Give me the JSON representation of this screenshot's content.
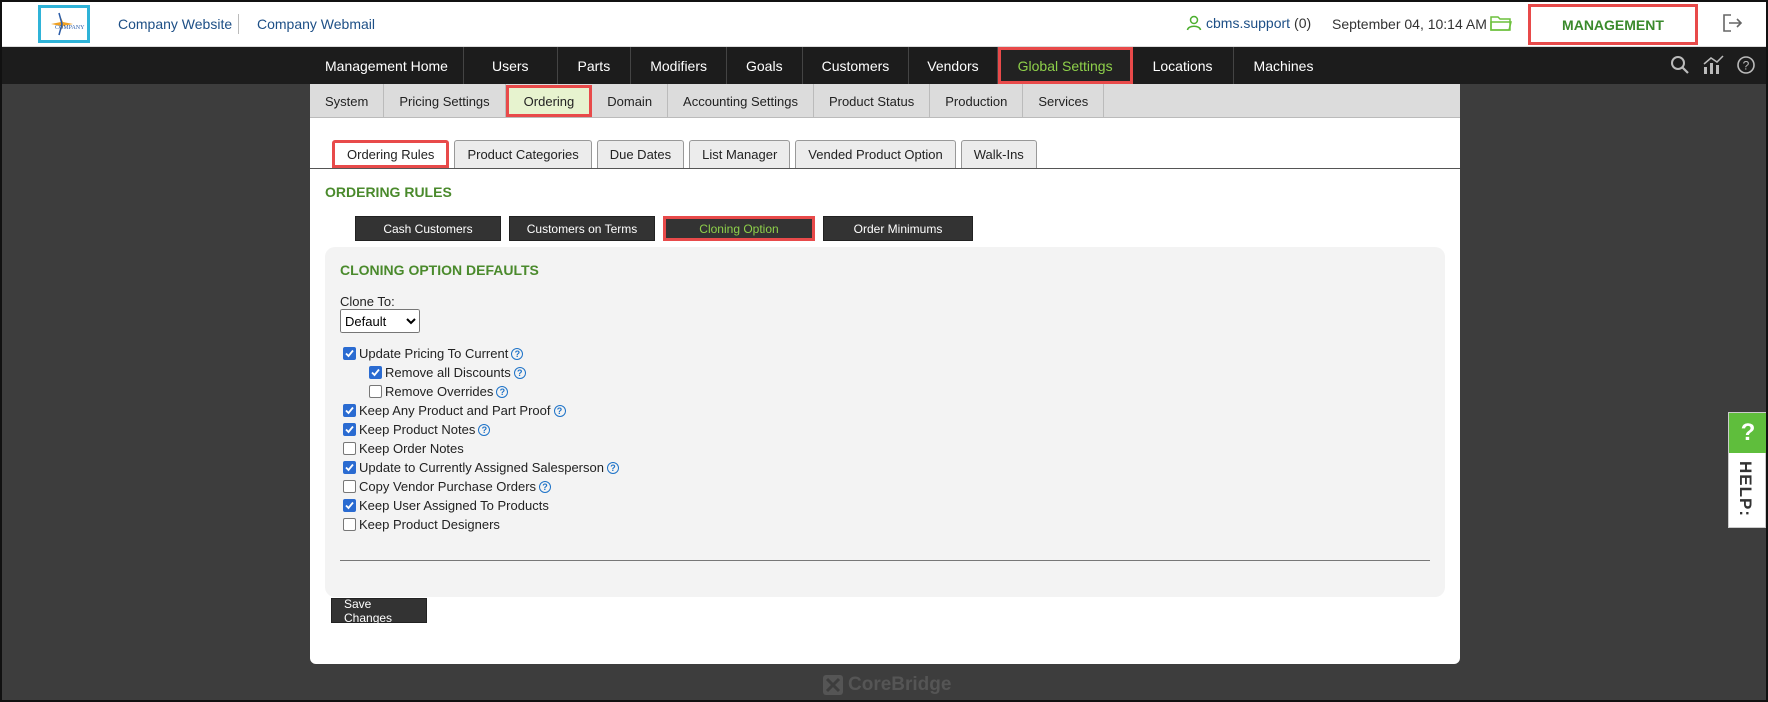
{
  "header": {
    "logo_text": "COMPANY",
    "links": [
      "Company Website",
      "Company Webmail"
    ],
    "username": "cbms.support",
    "user_count": "(0)",
    "datetime": "September 04, 10:14 AM",
    "management_label": "MANAGEMENT"
  },
  "main_nav": {
    "items": [
      "Management Home",
      "Users",
      "Parts",
      "Modifiers",
      "Goals",
      "Customers",
      "Vendors",
      "Global Settings",
      "Locations",
      "Machines"
    ],
    "active": "Global Settings"
  },
  "sub_nav": {
    "items": [
      "System",
      "Pricing Settings",
      "Ordering",
      "Domain",
      "Accounting Settings",
      "Product Status",
      "Production",
      "Services"
    ],
    "active": "Ordering"
  },
  "tabs": {
    "items": [
      "Ordering Rules",
      "Product Categories",
      "Due Dates",
      "List Manager",
      "Vended Product Option",
      "Walk-Ins"
    ],
    "active": "Ordering Rules"
  },
  "section_title": "ORDERING RULES",
  "rule_buttons": {
    "items": [
      "Cash Customers",
      "Customers on Terms",
      "Cloning Option",
      "Order Minimums"
    ],
    "active": "Cloning Option"
  },
  "cloning": {
    "title": "CLONING OPTION DEFAULTS",
    "clone_to_label": "Clone To:",
    "clone_to_value": "Default",
    "options": [
      {
        "label": "Update Pricing To Current",
        "checked": true,
        "help": true,
        "indent": false
      },
      {
        "label": "Remove all Discounts",
        "checked": true,
        "help": true,
        "indent": true
      },
      {
        "label": "Remove Overrides",
        "checked": false,
        "help": true,
        "indent": true
      },
      {
        "label": "Keep Any Product and Part Proof",
        "checked": true,
        "help": true,
        "indent": false
      },
      {
        "label": "Keep Product Notes",
        "checked": true,
        "help": true,
        "indent": false
      },
      {
        "label": "Keep Order Notes",
        "checked": false,
        "help": false,
        "indent": false
      },
      {
        "label": "Update to Currently Assigned Salesperson",
        "checked": true,
        "help": true,
        "indent": false
      },
      {
        "label": "Copy Vendor Purchase Orders",
        "checked": false,
        "help": true,
        "indent": false
      },
      {
        "label": "Keep User Assigned To Products",
        "checked": true,
        "help": false,
        "indent": false
      },
      {
        "label": "Keep Product Designers",
        "checked": false,
        "help": false,
        "indent": false
      }
    ]
  },
  "save_label": "Save Changes",
  "footer_brand": "CoreBridge",
  "help_tab": {
    "q": "?",
    "text": "HELP:"
  },
  "colors": {
    "accent_green": "#4a8a2c",
    "highlight_red": "#e84a4a",
    "nav_dark": "#1c1c1c"
  }
}
